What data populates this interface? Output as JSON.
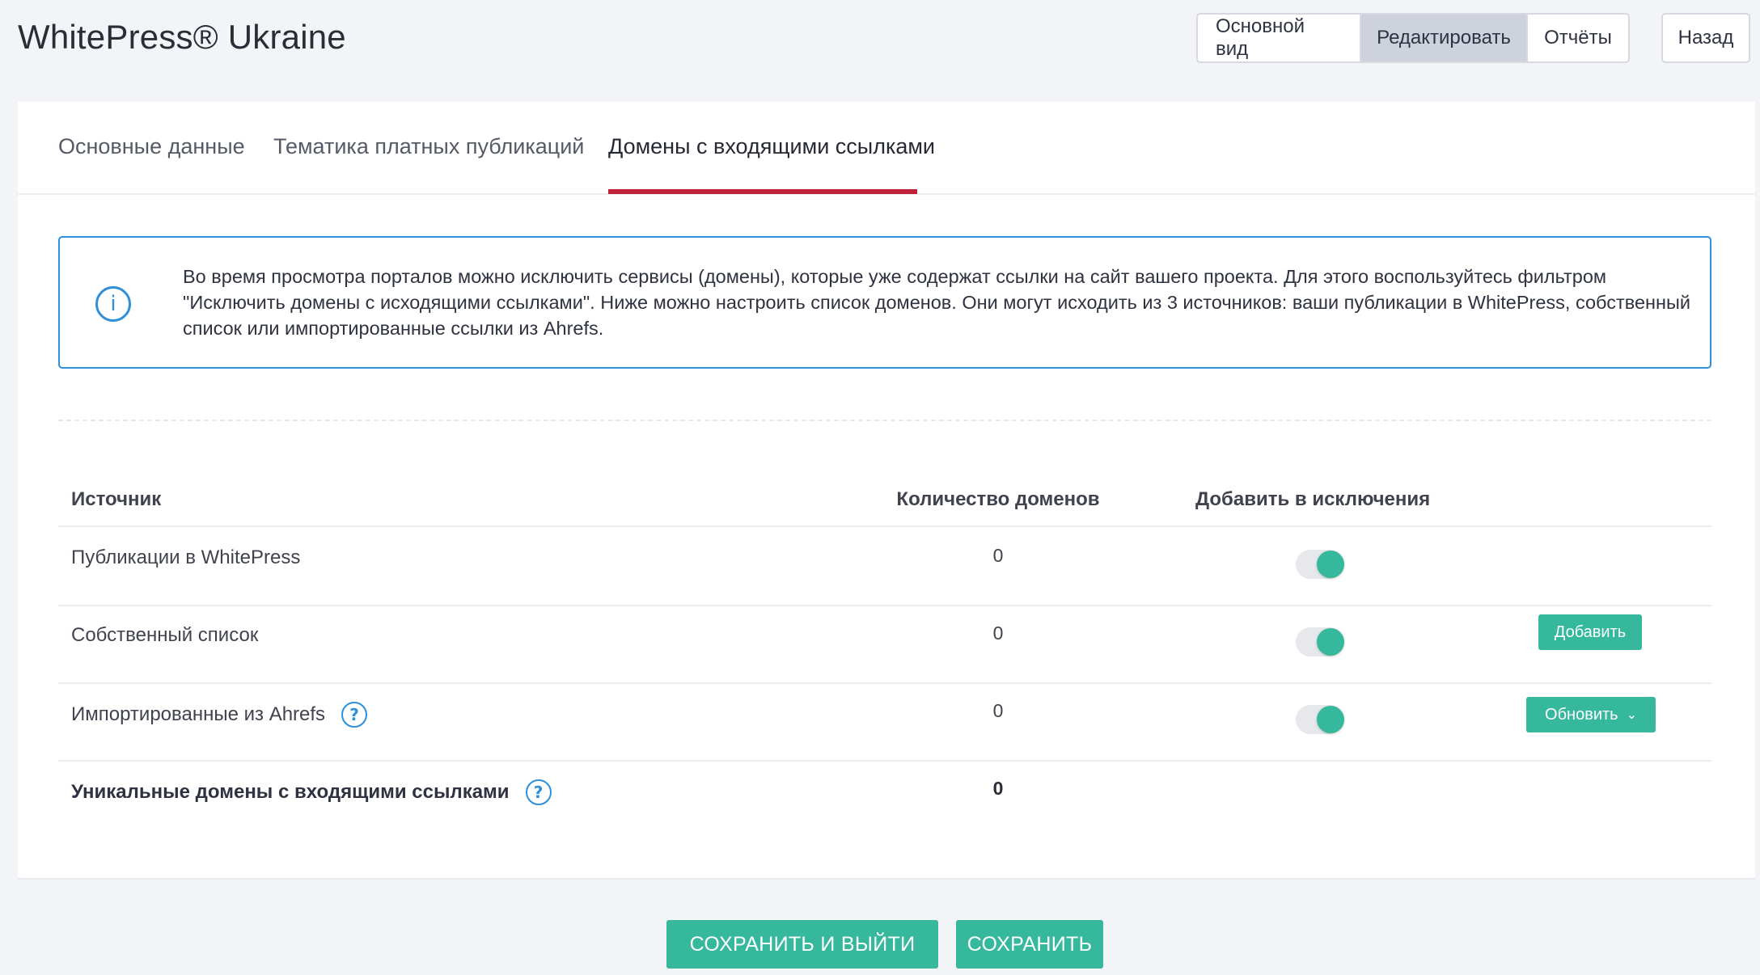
{
  "header": {
    "title": "WhitePress® Ukraine",
    "view_buttons": [
      "Основной вид",
      "Редактировать",
      "Отчёты"
    ],
    "back_label": "Назад"
  },
  "tabs": [
    {
      "label": "Основные данные"
    },
    {
      "label": "Тематика платных публикаций"
    },
    {
      "label": "Домены с входящими ссылками"
    }
  ],
  "active_tab": "Домены с входящими ссылками",
  "info": {
    "text": "Во время просмотра порталов можно исключить сервисы (домены), которые уже содержат ссылки на сайт вашего проекта. Для этого воспользуйтесь фильтром \"Исключить домены с исходящими ссылками\". Ниже можно настроить список доменов. Они могут исходить из 3 источников: ваши публикации в WhitePress, собственный список или импортированные ссылки из Ahrefs."
  },
  "table": {
    "headers": {
      "source": "Источник",
      "count": "Количество доменов",
      "exclude": "Добавить в исключения"
    },
    "rows": [
      {
        "source": "Публикации в WhitePress",
        "count": "0",
        "excluded": true
      },
      {
        "source": "Собственный список",
        "count": "0",
        "excluded": true,
        "action": "Добавить"
      },
      {
        "source": "Импортированные из Ahrefs",
        "count": "0",
        "excluded": true,
        "action": "Обновить"
      }
    ],
    "total": {
      "label": "Уникальные домены с входящими ссылками",
      "count": "0"
    }
  },
  "footer": {
    "save_exit_label": "СОХРАНИТЬ И ВЫЙТИ",
    "save_label": "СОХРАНИТЬ"
  },
  "colors": {
    "accent_green": "#35b89b",
    "info_blue": "#2f8fd8",
    "tab_underline": "#c0203a"
  }
}
